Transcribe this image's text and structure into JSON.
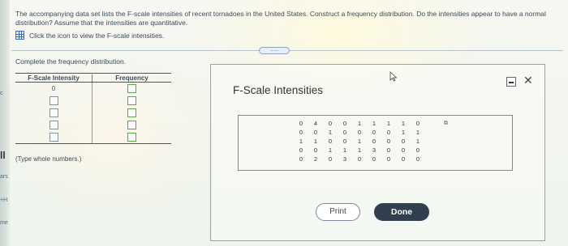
{
  "question": {
    "text": "The accompanying data set lists the F-scale intensities of recent tornadoes in the United States. Construct a frequency distribution. Do the intensities appear to have a normal distribution? Assume that the intensities are quantitative.",
    "hint": "Click the icon to view the F-scale intensities."
  },
  "expand_label": "......",
  "instructions": "Complete the frequency distribution.",
  "freq_table": {
    "headers": [
      "F-Scale Intensity",
      "Frequency"
    ],
    "rows": [
      {
        "intensity": "0",
        "frequency": ""
      },
      {
        "intensity": "",
        "frequency": ""
      },
      {
        "intensity": "",
        "frequency": ""
      },
      {
        "intensity": "",
        "frequency": ""
      },
      {
        "intensity": "",
        "frequency": ""
      }
    ]
  },
  "type_note": "(Type whole numbers.)",
  "left_edge": [
    "c",
    "ll",
    "ars",
    "+H",
    "me"
  ],
  "popup": {
    "title": "F-Scale Intensities",
    "close_label": "✕",
    "data": [
      [
        "0",
        "4",
        "0",
        "0",
        "1",
        "1",
        "1",
        "1",
        "0",
        ""
      ],
      [
        "0",
        "0",
        "1",
        "0",
        "0",
        "0",
        "0",
        "1",
        "1",
        ""
      ],
      [
        "1",
        "1",
        "0",
        "0",
        "1",
        "0",
        "0",
        "0",
        "1",
        ""
      ],
      [
        "0",
        "0",
        "1",
        "1",
        "1",
        "3",
        "0",
        "0",
        "0",
        ""
      ],
      [
        "0",
        "2",
        "0",
        "3",
        "0",
        "0",
        "0",
        "0",
        "0",
        ""
      ]
    ],
    "print_label": "Print",
    "done_label": "Done"
  },
  "colors": {
    "done_bg": "#30404f",
    "link_blue": "#3b6fb0"
  }
}
